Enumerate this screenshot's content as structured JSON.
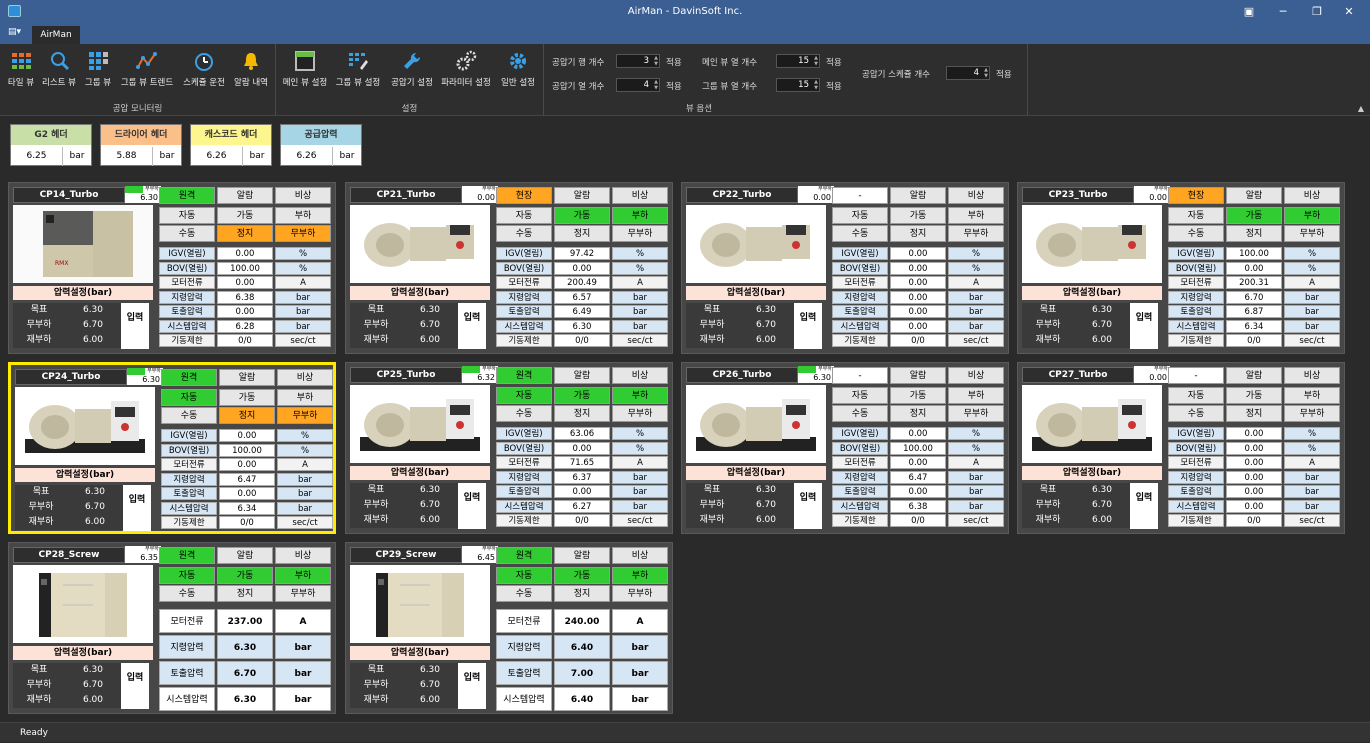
{
  "window": {
    "title": "AirMan - DavinSoft Inc.",
    "tab": "AirMan",
    "status": "Ready"
  },
  "ribbon": {
    "groups": [
      {
        "label": "공압 모니터링",
        "buttons": [
          "타일 뷰",
          "리스트 뷰",
          "그룹 뷰",
          "그룹 뷰 트렌드",
          "스케쥴 운전",
          "알람 내역"
        ]
      },
      {
        "label": "설정",
        "buttons": [
          "메인 뷰 설정",
          "그룹 뷰 설정",
          "공압기 설정",
          "파라미터 설정",
          "일반 설정"
        ]
      },
      {
        "label": "뷰 옵션"
      }
    ],
    "options": {
      "row_count": {
        "label": "공압기 행 개수",
        "value": "3",
        "apply": "적용"
      },
      "col_count": {
        "label": "공압기 열 개수",
        "value": "4",
        "apply": "적용"
      },
      "main_cols": {
        "label": "메인 뷰 열 개수",
        "value": "15",
        "apply": "적용"
      },
      "group_cols": {
        "label": "그룹 뷰 열 개수",
        "value": "15",
        "apply": "적용"
      },
      "sched_count": {
        "label": "공압기 스케쥴 개수",
        "value": "4",
        "apply": "적용"
      }
    }
  },
  "headers": [
    {
      "name": "G2 헤더",
      "value": "6.25",
      "unit": "bar",
      "color": "#c9dfa8"
    },
    {
      "name": "드라이어 헤더",
      "value": "5.88",
      "unit": "bar",
      "color": "#fbbf8a"
    },
    {
      "name": "캐스코드 헤더",
      "value": "6.26",
      "unit": "bar",
      "color": "#fdf58e"
    },
    {
      "name": "공급압력",
      "value": "6.26",
      "unit": "bar",
      "color": "#a6d5e6"
    }
  ],
  "ui_labels": {
    "remote": "원격",
    "local": "현장",
    "dash": "-",
    "alarm": "알람",
    "emergency": "비상",
    "auto": "자동",
    "manual": "수동",
    "run": "가동",
    "stop": "정지",
    "load": "부하",
    "unload": "무부하",
    "pressure_setting": "압력설정(bar)",
    "target": "목표",
    "unload_p": "무부하",
    "reload": "재부하",
    "input": "입력",
    "run_small": "가동",
    "load_small": "무부하",
    "stop_small": "정지"
  },
  "compressors": [
    {
      "name": "CP14_Turbo",
      "pressure": "6.30",
      "type": "turbo",
      "ctrl": "원격",
      "ctrl_state": "green",
      "auto_state": "none",
      "run_state": "none",
      "stop_state": "orange",
      "unload_state": "orange",
      "run_lbl_state": "green",
      "igv": "0.00",
      "bov": "100.00",
      "current": "0.00",
      "cmd": "6.38",
      "discharge": "0.00",
      "system": "6.28",
      "limit": "0/0",
      "target": "6.30",
      "unload": "6.70",
      "reload": "6.00",
      "img": "rm"
    },
    {
      "name": "CP21_Turbo",
      "pressure": "0.00",
      "type": "turbo",
      "ctrl": "현장",
      "ctrl_state": "orange",
      "auto_state": "none",
      "run_state": "green",
      "stop_state": "none",
      "unload_state": "none",
      "load_state": "green",
      "run_lbl_state": "none",
      "igv": "97.42",
      "bov": "0.00",
      "current": "200.49",
      "cmd": "6.57",
      "discharge": "6.49",
      "system": "6.30",
      "limit": "0/0",
      "target": "6.30",
      "unload": "6.70",
      "reload": "6.00",
      "img": "cent"
    },
    {
      "name": "CP22_Turbo",
      "pressure": "0.00",
      "type": "turbo",
      "ctrl": "-",
      "ctrl_state": "none",
      "run_state": "none",
      "stop_state": "none",
      "unload_state": "none",
      "run_lbl_state": "none",
      "stop_lbl": true,
      "igv": "0.00",
      "bov": "0.00",
      "current": "0.00",
      "cmd": "0.00",
      "discharge": "0.00",
      "system": "0.00",
      "limit": "0/0",
      "target": "6.30",
      "unload": "6.70",
      "reload": "6.00",
      "img": "cent"
    },
    {
      "name": "CP23_Turbo",
      "pressure": "0.00",
      "type": "turbo",
      "ctrl": "현장",
      "ctrl_state": "orange",
      "run_state": "green",
      "load_state": "green",
      "stop_state": "none",
      "unload_state": "none",
      "run_lbl_state": "none",
      "igv": "100.00",
      "bov": "0.00",
      "current": "200.31",
      "cmd": "6.70",
      "discharge": "6.87",
      "system": "6.34",
      "limit": "0/0",
      "target": "6.30",
      "unload": "6.70",
      "reload": "6.00",
      "img": "cent"
    },
    {
      "name": "CP24_Turbo",
      "pressure": "6.30",
      "type": "turbo",
      "ctrl": "원격",
      "ctrl_state": "green",
      "auto_state": "green",
      "stop_state": "orange",
      "unload_state": "orange",
      "run_lbl_state": "green",
      "selected": true,
      "igv": "0.00",
      "bov": "100.00",
      "current": "0.00",
      "cmd": "6.47",
      "discharge": "0.00",
      "system": "6.34",
      "limit": "0/0",
      "target": "6.30",
      "unload": "6.70",
      "reload": "6.00",
      "img": "cent2"
    },
    {
      "name": "CP25_Turbo",
      "pressure": "6.32",
      "type": "turbo",
      "ctrl": "원격",
      "ctrl_state": "green",
      "auto_state": "green",
      "run_state": "green",
      "load_state": "green",
      "run_lbl_state": "green",
      "igv": "63.06",
      "bov": "0.00",
      "current": "71.65",
      "cmd": "6.37",
      "discharge": "0.00",
      "system": "6.27",
      "limit": "0/0",
      "target": "6.30",
      "unload": "6.70",
      "reload": "6.00",
      "img": "cent2"
    },
    {
      "name": "CP26_Turbo",
      "pressure": "6.30",
      "type": "turbo",
      "ctrl": "-",
      "ctrl_state": "none",
      "run_lbl_state": "green",
      "igv": "0.00",
      "bov": "100.00",
      "current": "0.00",
      "cmd": "6.47",
      "discharge": "0.00",
      "system": "6.38",
      "limit": "0/0",
      "target": "6.30",
      "unload": "6.70",
      "reload": "6.00",
      "img": "cent2"
    },
    {
      "name": "CP27_Turbo",
      "pressure": "0.00",
      "type": "turbo",
      "ctrl": "-",
      "ctrl_state": "none",
      "stop_lbl": true,
      "run_lbl_state": "none",
      "igv": "0.00",
      "bov": "0.00",
      "current": "0.00",
      "cmd": "0.00",
      "discharge": "0.00",
      "system": "0.00",
      "limit": "0/0",
      "target": "6.30",
      "unload": "6.70",
      "reload": "6.00",
      "img": "cent2"
    },
    {
      "name": "CP28_Screw",
      "pressure": "6.35",
      "type": "screw",
      "ctrl": "원격",
      "ctrl_state": "green",
      "auto_state": "green",
      "run_state": "green",
      "load_state": "green",
      "current": "237.00",
      "cmd": "6.30",
      "discharge": "6.70",
      "system": "6.30",
      "target": "6.30",
      "unload": "6.70",
      "reload": "6.00",
      "img": "screw"
    },
    {
      "name": "CP29_Screw",
      "pressure": "6.45",
      "type": "screw",
      "ctrl": "원격",
      "ctrl_state": "green",
      "auto_state": "green",
      "run_state": "green",
      "load_state": "green",
      "current": "240.00",
      "cmd": "6.40",
      "discharge": "7.00",
      "system": "6.40",
      "target": "6.30",
      "unload": "6.70",
      "reload": "6.00",
      "img": "screw"
    }
  ],
  "turbo_rows": [
    {
      "label": "IGV(열림)",
      "key": "igv",
      "unit": "%"
    },
    {
      "label": "BOV(열림)",
      "key": "bov",
      "unit": "%"
    },
    {
      "label": "모터전류",
      "key": "current",
      "unit": "A"
    },
    {
      "label": "지령압력",
      "key": "cmd",
      "unit": "bar"
    },
    {
      "label": "토출압력",
      "key": "discharge",
      "unit": "bar"
    },
    {
      "label": "시스템압력",
      "key": "system",
      "unit": "bar"
    },
    {
      "label": "기동제한",
      "key": "limit",
      "unit": "sec/ct"
    }
  ],
  "screw_rows": [
    {
      "label": "모터전류",
      "key": "current",
      "unit": "A"
    },
    {
      "label": "지령압력",
      "key": "cmd",
      "unit": "bar"
    },
    {
      "label": "토출압력",
      "key": "discharge",
      "unit": "bar"
    },
    {
      "label": "시스템압력",
      "key": "system",
      "unit": "bar"
    }
  ],
  "colors": {
    "green": "#31cc31",
    "orange": "#ffa521",
    "selected": "#ffeb00"
  }
}
